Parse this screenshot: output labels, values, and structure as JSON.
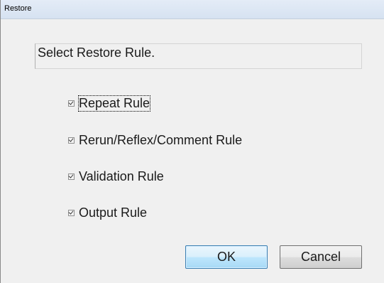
{
  "window": {
    "title": "Restore"
  },
  "prompt": {
    "text": "Select Restore Rule."
  },
  "options": [
    {
      "label": "Repeat Rule",
      "checked": true
    },
    {
      "label": "Rerun/Reflex/Comment Rule",
      "checked": true
    },
    {
      "label": "Validation Rule",
      "checked": true
    },
    {
      "label": "Output Rule",
      "checked": true
    }
  ],
  "buttons": {
    "ok_label": "OK",
    "cancel_label": "Cancel"
  },
  "colors": {
    "window_bg": "#f0f0f0",
    "titlebar": "#dce6f4",
    "default_button_border": "#3c7fb1"
  }
}
